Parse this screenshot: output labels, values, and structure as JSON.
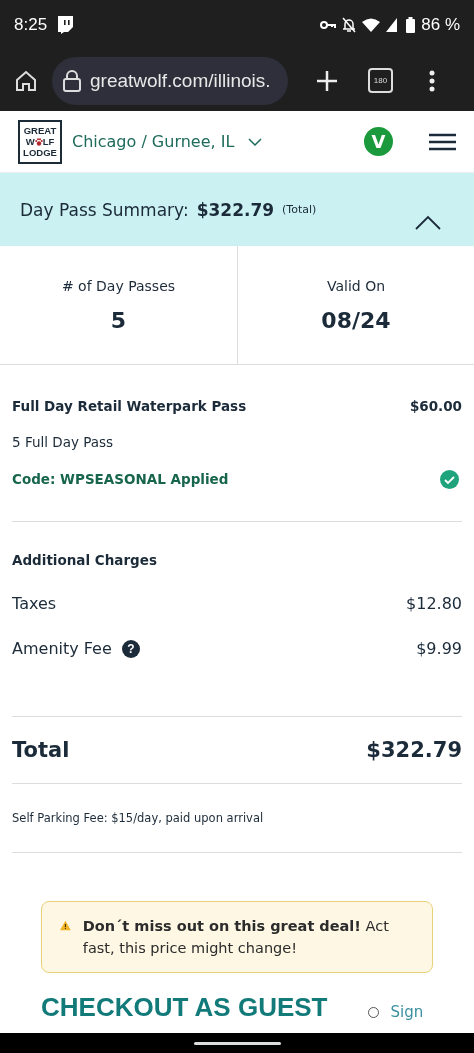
{
  "status_bar": {
    "time": "8:25",
    "battery": "86 %"
  },
  "browser": {
    "url": "greatwolf.com/illinois.",
    "tab_count": "180"
  },
  "header": {
    "logo": {
      "top": "GREAT",
      "middle_start": "W",
      "middle_end": "LF",
      "bottom": "LODGE"
    },
    "location": "Chicago / Gurnee, IL",
    "avatar": "V"
  },
  "summary": {
    "label": "Day Pass Summary:",
    "total": "$322.79",
    "note": "(Total)",
    "expanded": true
  },
  "stats": [
    {
      "label": "# of Day Passes",
      "value": "5"
    },
    {
      "label": "Valid On",
      "value": "08/24"
    }
  ],
  "pass": {
    "name": "Full Day Retail Waterpark Pass",
    "price": "$60.00",
    "quantity": "5 Full Day Pass",
    "code": "Code: WPSEASONAL Applied",
    "applied": true
  },
  "additional": {
    "title": "Additional Charges",
    "charges": [
      {
        "label": "Taxes",
        "amount": "$12.80"
      },
      {
        "label": "Amenity Fee",
        "amount": "$9.99",
        "info_icon": "?"
      }
    ]
  },
  "total": {
    "label": "Total",
    "amount": "$322.79"
  },
  "parking_note": "Self Parking Fee: $15/day, paid upon arrival",
  "alert": {
    "text": "**Don´t miss out on this great deal!** Act fast, this price might change!"
  },
  "checkout": {
    "title": "CHECKOUT AS GUEST",
    "sign_in": "Sign"
  }
}
